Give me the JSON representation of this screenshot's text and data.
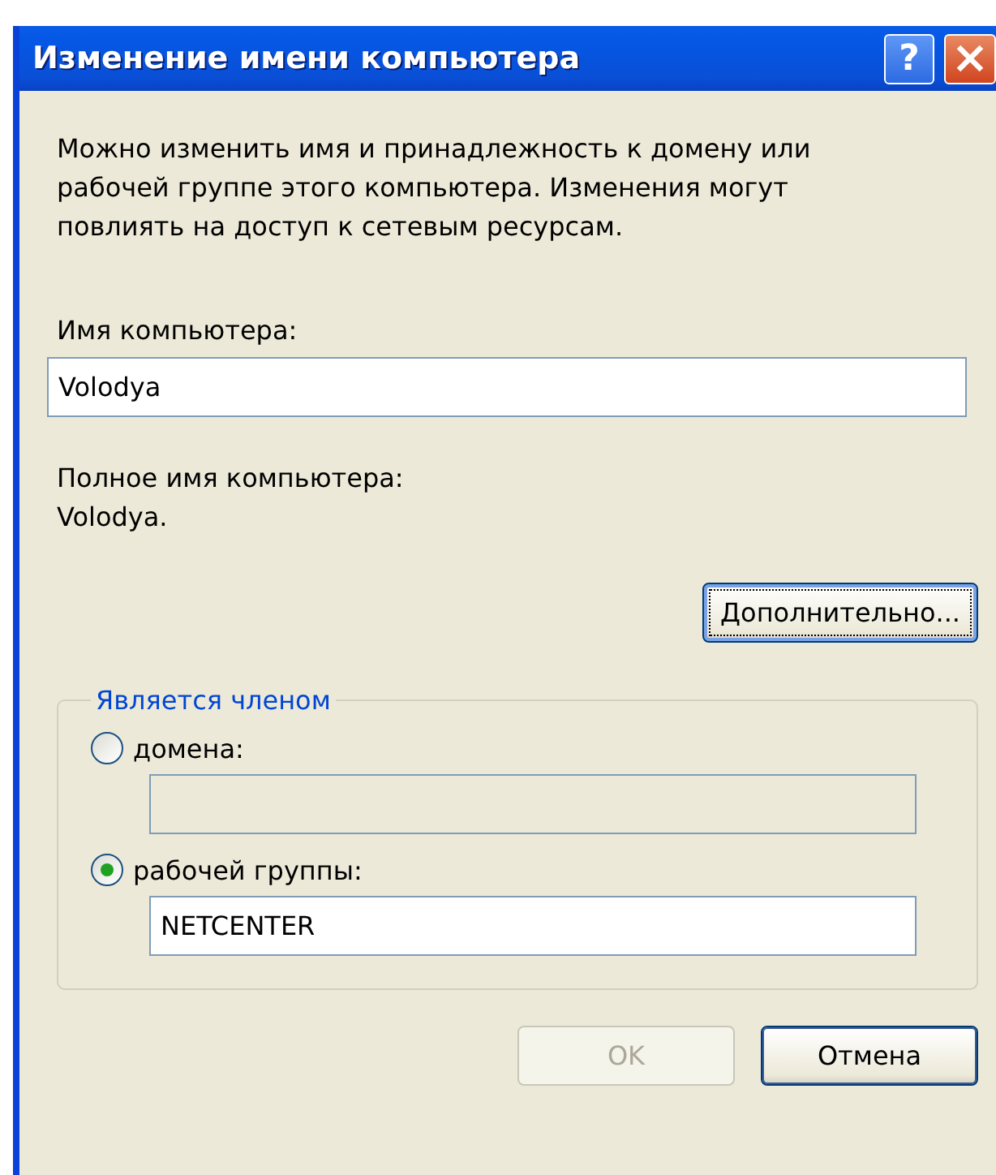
{
  "window": {
    "title": "Изменение имени компьютера",
    "help_button": "?"
  },
  "description": "Можно изменить имя и принадлежность к домену или рабочей группе этого компьютера. Изменения могут повлиять на доступ к сетевым ресурсам.",
  "computer_name": {
    "label": "Имя компьютера:",
    "value": "Volodya"
  },
  "full_name": {
    "label": "Полное имя компьютера:",
    "value": "Volodya."
  },
  "advanced_button": {
    "label": "Дополнительно...",
    "focused": true
  },
  "member_of": {
    "legend": "Является членом",
    "options": [
      {
        "label": "домена:",
        "selected": false,
        "field": {
          "disabled": true
        }
      },
      {
        "label": "рабочей группы:",
        "selected": true,
        "field": {
          "value": "NETCENTER",
          "disabled": false
        }
      }
    ]
  },
  "buttons": [
    {
      "label": "OK",
      "disabled": true
    },
    {
      "label": "Отмена",
      "disabled": false
    }
  ]
}
